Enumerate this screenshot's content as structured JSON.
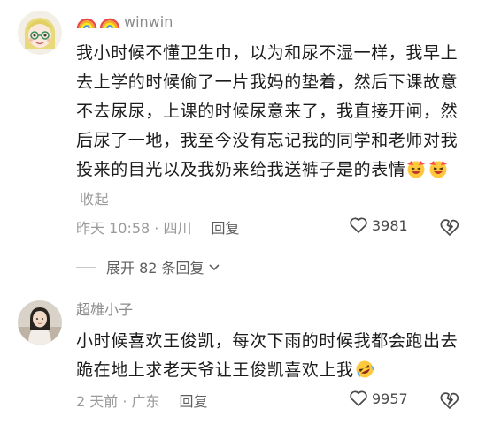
{
  "comments": [
    {
      "username": "winwin",
      "body_text": "我小时候不懂卫生巾，以为和尿不湿一样，我早上去上学的时候偷了一片我妈的垫着，然后下课故意不去尿尿，上课的时候尿意来了，我直接开闸，然后尿了一地，我至今没有忘记我的同学和老师对我投来的目光以及我奶来给我送裤子是的表情",
      "collapse_label": "收起",
      "time_location": "昨天 10:58 · 四川",
      "reply_label": "回复",
      "like_count": "3981",
      "name_badges": [
        "rainbow-icon",
        "rainbow-icon"
      ],
      "trailing_emojis": [
        "laughing-face-icon",
        "laughing-face-icon"
      ]
    },
    {
      "username": "超雄小子",
      "body_text": "小时候喜欢王俊凯，每次下雨的时候我都会跑出去跪在地上求老天爷让王俊凯喜欢上我",
      "time_location": "2 天前 · 广东",
      "reply_label": "回复",
      "like_count": "9957",
      "trailing_emojis": [
        "rofl-face-icon"
      ]
    }
  ],
  "expand_replies_label": "展开 82 条回复",
  "colors": {
    "text_primary": "#1b1b1b",
    "text_secondary": "#9a9a9a",
    "username": "#8a8a8a"
  }
}
